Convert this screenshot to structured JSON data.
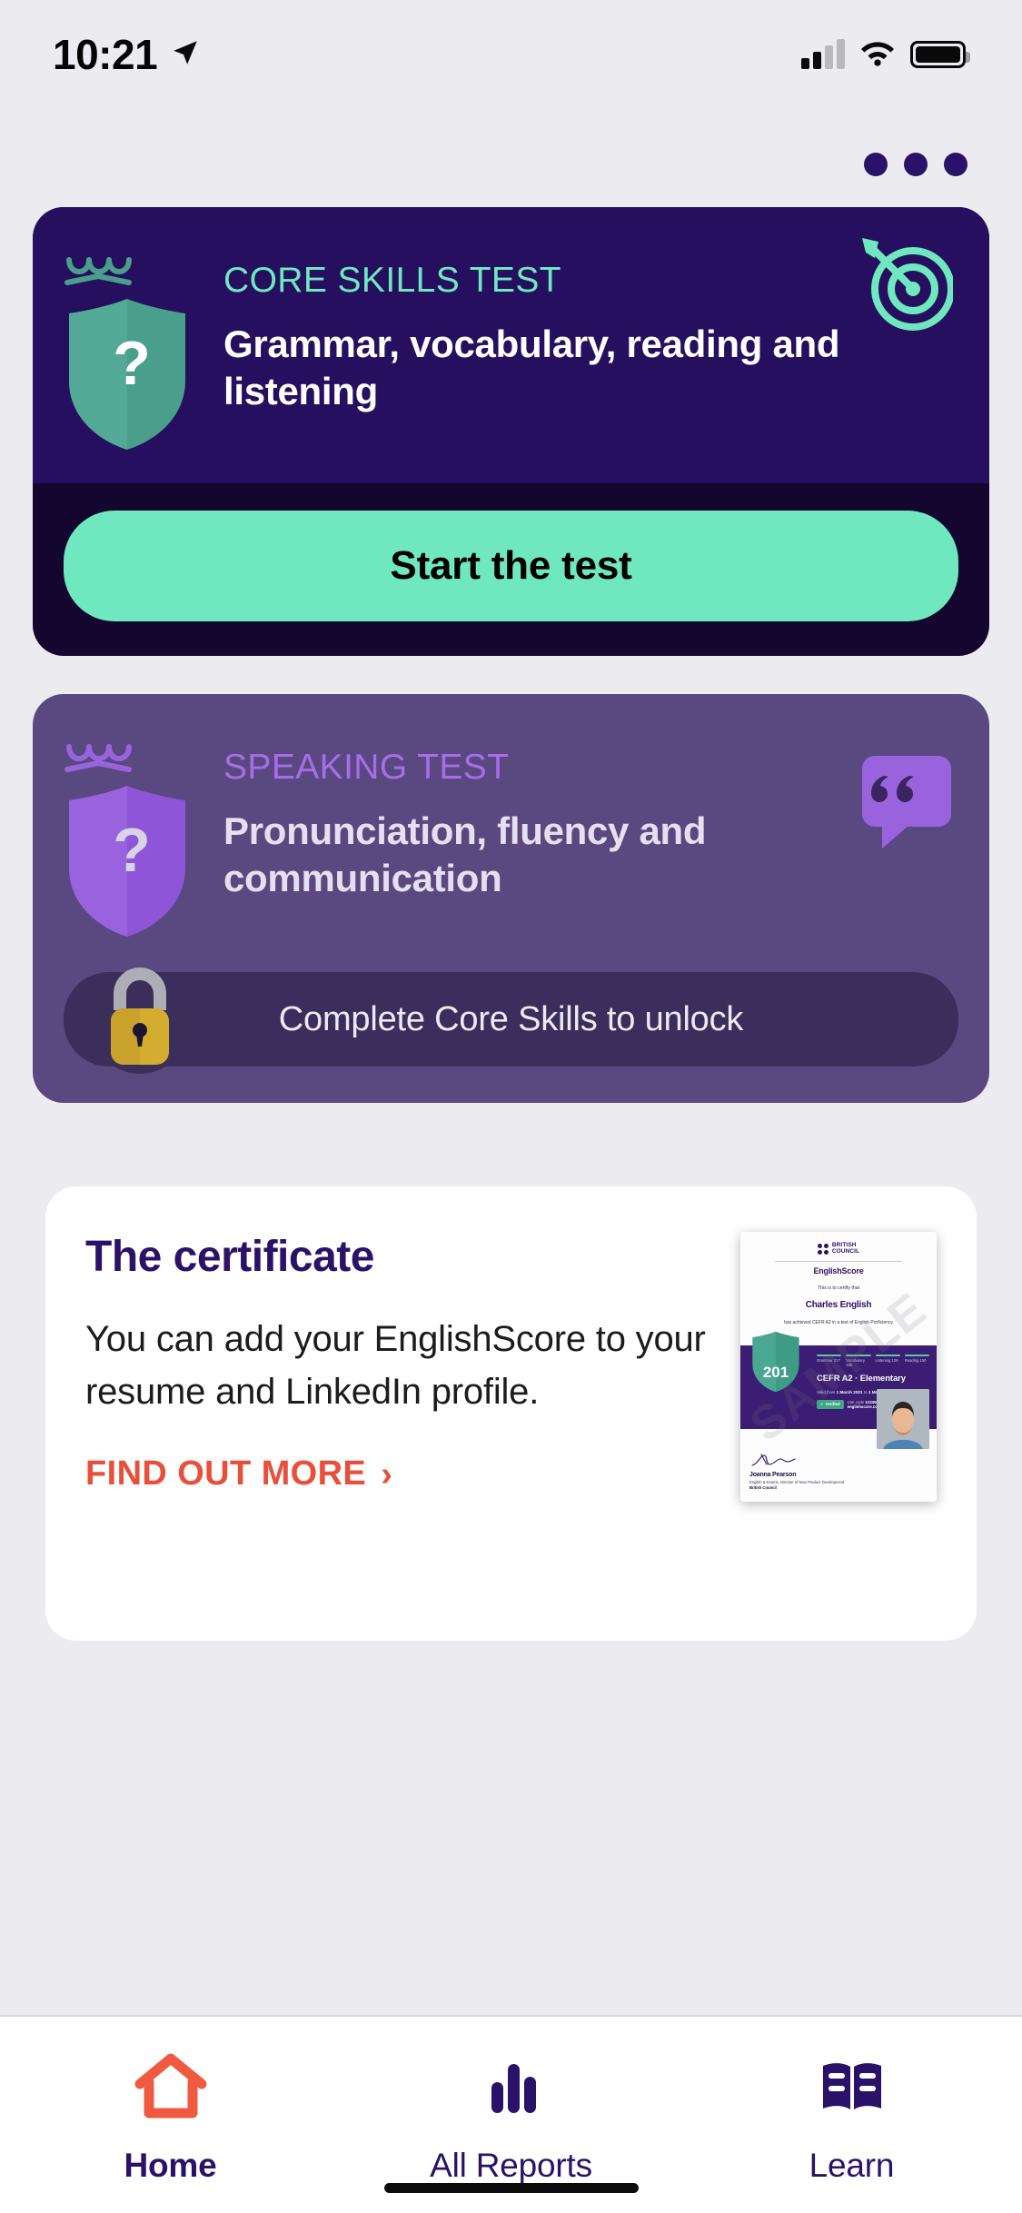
{
  "status_bar": {
    "time": "10:21",
    "location_icon": "location-arrow-icon",
    "cellular_icon": "cellular-signal-icon",
    "wifi_icon": "wifi-icon",
    "battery_icon": "battery-full-icon"
  },
  "pager": {
    "dots_icon": "three-dots-icon",
    "count": 3
  },
  "core_skills_card": {
    "kicker": "CORE SKILLS TEST",
    "headline": "Grammar, vocabulary, reading and listening",
    "shield_glyph": "?",
    "shield_icon": "crowned-shield-icon",
    "corner_icon": "target-arrow-icon",
    "start_button": "Start the test",
    "colors": {
      "card_bg": "#260F5E",
      "footer_bg": "#130730",
      "accent": "#6FE8C0"
    }
  },
  "speaking_card": {
    "kicker": "SPEAKING TEST",
    "headline": "Pronunciation, fluency and communication",
    "shield_glyph": "?",
    "shield_icon": "crowned-shield-icon",
    "corner_icon": "speech-bubble-quote-icon",
    "locked_label": "Complete Core Skills to unlock",
    "lock_icon": "padlock-icon",
    "colors": {
      "card_bg": "#5A4980",
      "accent": "#A66DE8",
      "bar_bg": "#3C2E5C",
      "lock": "#D4AD30"
    }
  },
  "certificate_card": {
    "title": "The certificate",
    "body": "You can add your EnglishScore to your resume and LinkedIn profile.",
    "link_label": "FIND OUT MORE",
    "link_chevron_icon": "chevron-right-icon",
    "link_color": "#E8503C",
    "preview": {
      "brand_line1": "BRITISH",
      "brand_line2": "COUNCIL",
      "brand_mark_icon": "british-council-dots-icon",
      "product": "EnglishScore",
      "certify_line": "This is to certify that",
      "recipient": "Charles English",
      "achievement": "has achieved CEFR A2 in a test of English Proficiency",
      "score": "201",
      "shield_icon": "crowned-shield-icon",
      "subscores": [
        {
          "label": "Grammar 217"
        },
        {
          "label": "Vocabulary 195"
        },
        {
          "label": "Listening 129"
        },
        {
          "label": "Reading 150"
        }
      ],
      "level": "CEFR A2 · Elementary",
      "valid_prefix": "Valid from ",
      "valid_from": "1 March 2021",
      "valid_mid": " to ",
      "valid_to": "1 March 2022",
      "verified_badge": "Verified",
      "verified_check_icon": "check-icon",
      "code_prefix": "Use code ",
      "code": "1234567",
      "code_mid": " at ",
      "code_url": "englishscore.com/verify",
      "signatory_name": "Joanna Pearson",
      "signatory_role": "English & Exams, Director of New Product Development",
      "signatory_org": "British Council",
      "signature_icon": "signature-icon",
      "photo_icon": "portrait-photo-icon",
      "watermark": "SAMPLE"
    }
  },
  "tab_bar": {
    "items": [
      {
        "label": "Home",
        "icon": "home-icon",
        "active": true
      },
      {
        "label": "All Reports",
        "icon": "bar-chart-icon",
        "active": false
      },
      {
        "label": "Learn",
        "icon": "open-book-icon",
        "active": false
      }
    ],
    "active_color": "#E8503C",
    "inactive_color": "#2B1269"
  }
}
